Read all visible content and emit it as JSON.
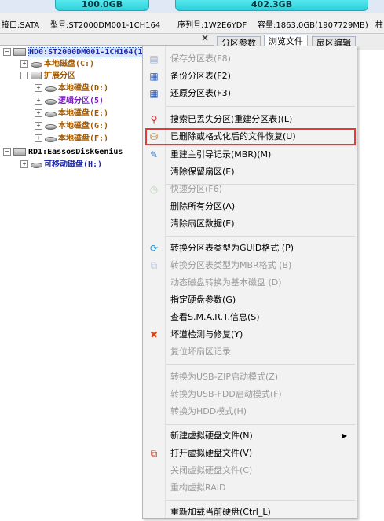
{
  "partition_bar": {
    "segment1": "100.0GB",
    "segment2": "402.3GB"
  },
  "disk_info": {
    "interface": "接口:SATA",
    "model": "型号:ST2000DM001-1CH164",
    "serial": "序列号:1W2E6YDF",
    "capacity": "容量:1863.0GB(1907729MB)",
    "extra": "柱"
  },
  "tree": {
    "close_symbol": "×",
    "hd0": "HD0:ST2000DM001-1CH164(1863GB)",
    "local_c": "本地磁盘(C:)",
    "extended": "扩展分区",
    "local_d": "本地磁盘(D:)",
    "logical_5": "逻辑分区(5)",
    "local_e": "本地磁盘(E:)",
    "local_g": "本地磁盘(G:)",
    "local_f": "本地磁盘(F:)",
    "rd1": "RD1:EassosDiskGenius",
    "removable_h": "可移动磁盘(H:)"
  },
  "tabs": [
    "分区参数",
    "浏览文件",
    "扇区编辑"
  ],
  "menu": {
    "items": [
      {
        "label": "保存分区表(F8)"
      },
      {
        "label": "备份分区表(F2)"
      },
      {
        "label": "还原分区表(F3)"
      },
      {
        "label": "搜索已丢失分区(重建分区表)(L)"
      },
      {
        "label": "已删除或格式化后的文件恢复(U)"
      },
      {
        "label": "重建主引导记录(MBR)(M)"
      },
      {
        "label": "清除保留扇区(E)"
      },
      {
        "label": "快速分区(F6)"
      },
      {
        "label": "删除所有分区(A)"
      },
      {
        "label": "清除扇区数据(E)"
      },
      {
        "label": "转换分区表类型为GUID格式 (P)"
      },
      {
        "label": "转换分区表类型为MBR格式 (B)"
      },
      {
        "label": "动态磁盘转换为基本磁盘 (D)"
      },
      {
        "label": "指定硬盘参数(G)"
      },
      {
        "label": "查看S.M.A.R.T.信息(S)"
      },
      {
        "label": "坏道检测与修复(Y)"
      },
      {
        "label": "复位坏扇区记录"
      },
      {
        "label": "转换为USB-ZIP启动模式(Z)"
      },
      {
        "label": "转换为USB-FDD启动模式(F)"
      },
      {
        "label": "转换为HDD模式(H)"
      },
      {
        "label": "新建虚拟硬盘文件(N)"
      },
      {
        "label": "打开虚拟硬盘文件(V)"
      },
      {
        "label": "关闭虚拟硬盘文件(C)"
      },
      {
        "label": "重构虚拟RAID"
      },
      {
        "label": "重新加载当前硬盘(Ctrl_L)"
      }
    ],
    "submenu_arrow": "▶"
  },
  "icons": {
    "save": "floppy-icon",
    "backup": "backup-icon",
    "restore": "restore-icon",
    "search": "search-partition-icon",
    "recover": "file-recovery-icon",
    "mbr": "mbr-edit-icon",
    "quick": "quick-partition-icon",
    "guid": "convert-guid-icon",
    "mbrconv": "convert-mbr-icon",
    "badsector": "repair-tools-icon",
    "vhdopen": "open-vhd-icon"
  },
  "colors": {
    "highlight_border": "#e5393a",
    "partition_cyan": "#2ed2dc"
  }
}
